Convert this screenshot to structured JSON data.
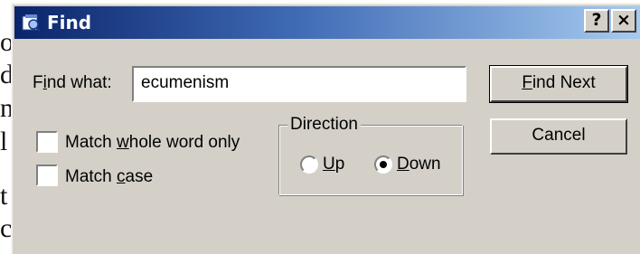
{
  "background_text": [
    "o",
    "d",
    "n",
    "l",
    "t",
    "c"
  ],
  "dialog": {
    "title": "Find",
    "help_button": "?",
    "close_button": "×",
    "find_what_label": "Find what:",
    "find_what_value": "ecumenism",
    "match_whole_word_label": "Match whole word only",
    "match_whole_word_checked": false,
    "match_case_label": "Match case",
    "match_case_checked": false,
    "direction": {
      "title": "Direction",
      "up_label": "Up",
      "down_label": "Down",
      "selected": "Down"
    },
    "find_next_label": "Find Next",
    "cancel_label": "Cancel"
  },
  "colors": {
    "title_gradient_start": "#0a246a",
    "title_gradient_end": "#a6caf0",
    "dialog_face": "#d4d0c8"
  }
}
